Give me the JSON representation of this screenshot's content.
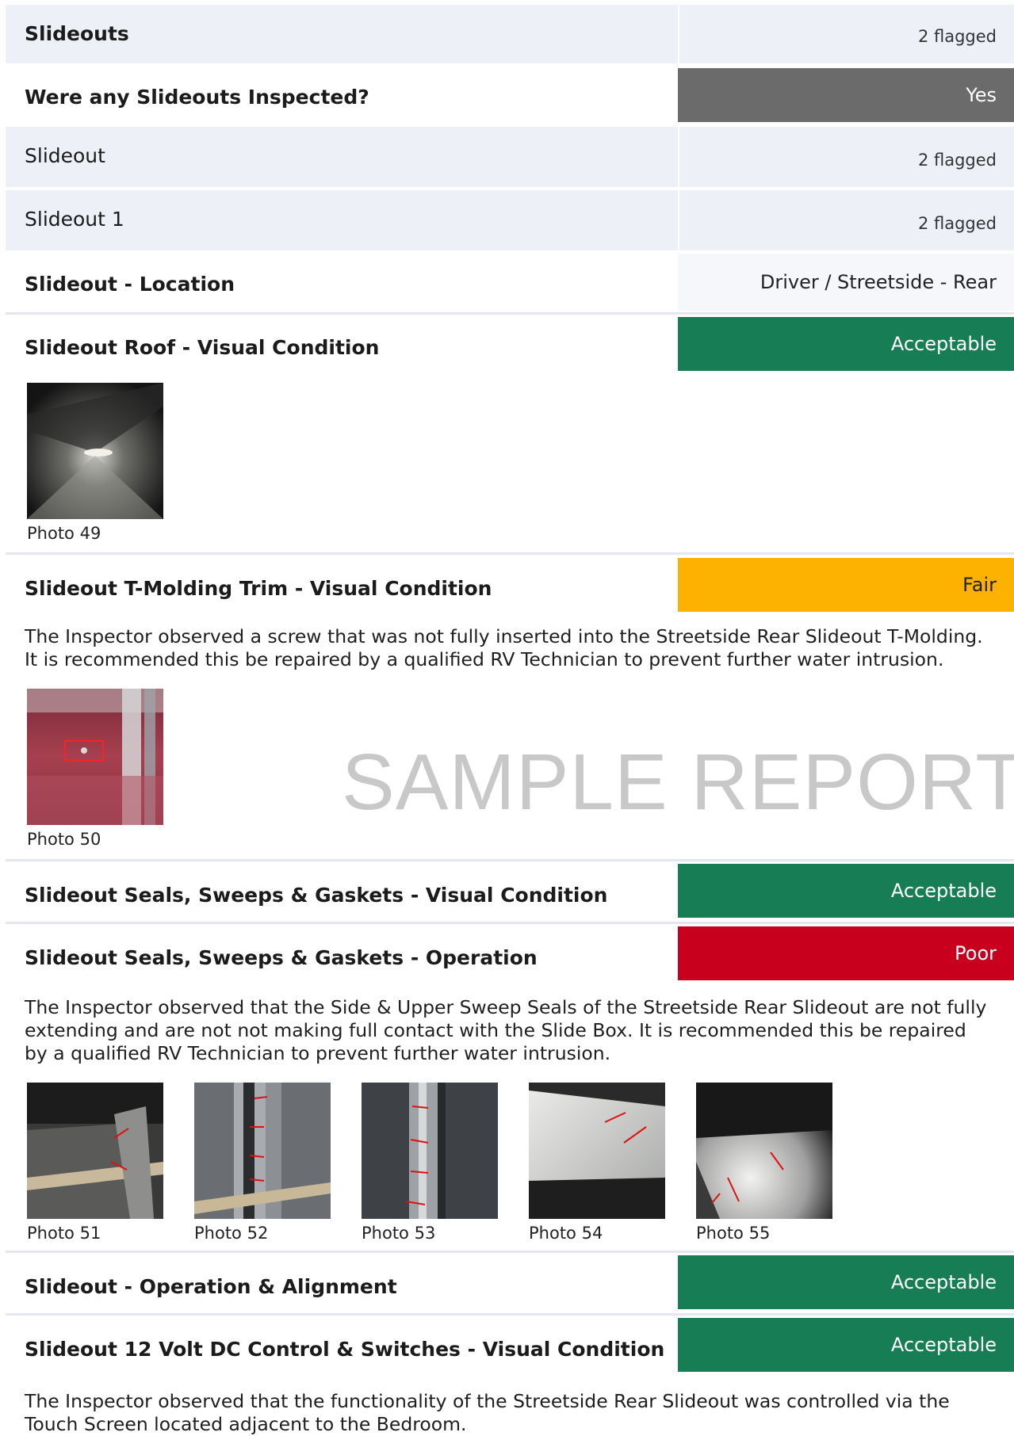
{
  "colors": {
    "section_bg": "#eef0f8",
    "neutral": "#6b6b6b",
    "acceptable": "#167d54",
    "fair": "#fdb100",
    "poor": "#c8001e",
    "watermark": "#c8c8c8"
  },
  "sections": [
    {
      "label": "Slideouts",
      "flag": "2 flagged"
    },
    {
      "label": "Slideout",
      "flag": "2 flagged"
    },
    {
      "label": "Slideout 1",
      "flag": "2 flagged"
    }
  ],
  "questions": {
    "inspected": {
      "label": "Were any Slideouts Inspected?",
      "answer": "Yes"
    },
    "location": {
      "label": "Slideout - Location",
      "answer": "Driver / Streetside - Rear"
    },
    "roof": {
      "label": "Slideout Roof - Visual Condition",
      "answer": "Acceptable"
    },
    "tmolding": {
      "label": "Slideout T-Molding Trim - Visual Condition",
      "answer": "Fair",
      "note": "The Inspector observed a screw that was not fully inserted into the Streetside Rear Slideout T-Molding. It is recommended this be repaired by a qualified RV Technician to prevent further water intrusion."
    },
    "seals_visual": {
      "label": "Slideout Seals, Sweeps & Gaskets - Visual Condition",
      "answer": "Acceptable"
    },
    "seals_operation": {
      "label": "Slideout Seals, Sweeps & Gaskets - Operation",
      "answer": "Poor",
      "note": "The Inspector observed that the Side & Upper Sweep Seals of the Streetside Rear Slideout are not fully extending and are not not making full contact with the Slide Box. It is recommended this be repaired by a qualified RV Technician to prevent further water intrusion."
    },
    "operation": {
      "label": "Slideout - Operation & Alignment",
      "answer": "Acceptable"
    },
    "control": {
      "label": "Slideout 12 Volt DC Control & Switches - Visual Condition",
      "answer": "Acceptable",
      "note": "The Inspector observed that the functionality of the Streetside Rear Slideout was controlled via the Touch Screen located adjacent to the Bedroom."
    }
  },
  "photos": {
    "p49": "Photo 49",
    "p50": "Photo 50",
    "p51": "Photo 51",
    "p52": "Photo 52",
    "p53": "Photo 53",
    "p54": "Photo 54",
    "p55": "Photo 55"
  },
  "watermark": "SAMPLE REPORT"
}
